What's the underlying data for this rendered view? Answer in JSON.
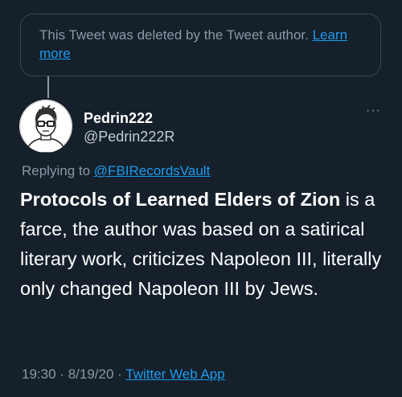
{
  "deleted_notice": {
    "text": "This Tweet was deleted by the Tweet author.",
    "link": "Learn more"
  },
  "author": {
    "display_name": "Pedrin222",
    "handle": "@Pedrin222R",
    "avatar": "cartoon-man-with-glasses"
  },
  "more_icon": "···",
  "reply": {
    "prefix": "Replying to",
    "handle": "@FBIRecordsVault"
  },
  "tweet": {
    "bold_text": "Protocols of Learned Elders of Zion",
    "text": " is a farce, the author was based on a satirical literary work, criticizes Napoleon III, literally only changed Napoleon III by Jews."
  },
  "meta": {
    "time": "19:30",
    "date": "8/19/20",
    "separator": "·",
    "source": "Twitter Web App"
  },
  "colors": {
    "background": "#15202b",
    "link": "#1d9bf0",
    "secondary_text": "#8b98a5"
  }
}
